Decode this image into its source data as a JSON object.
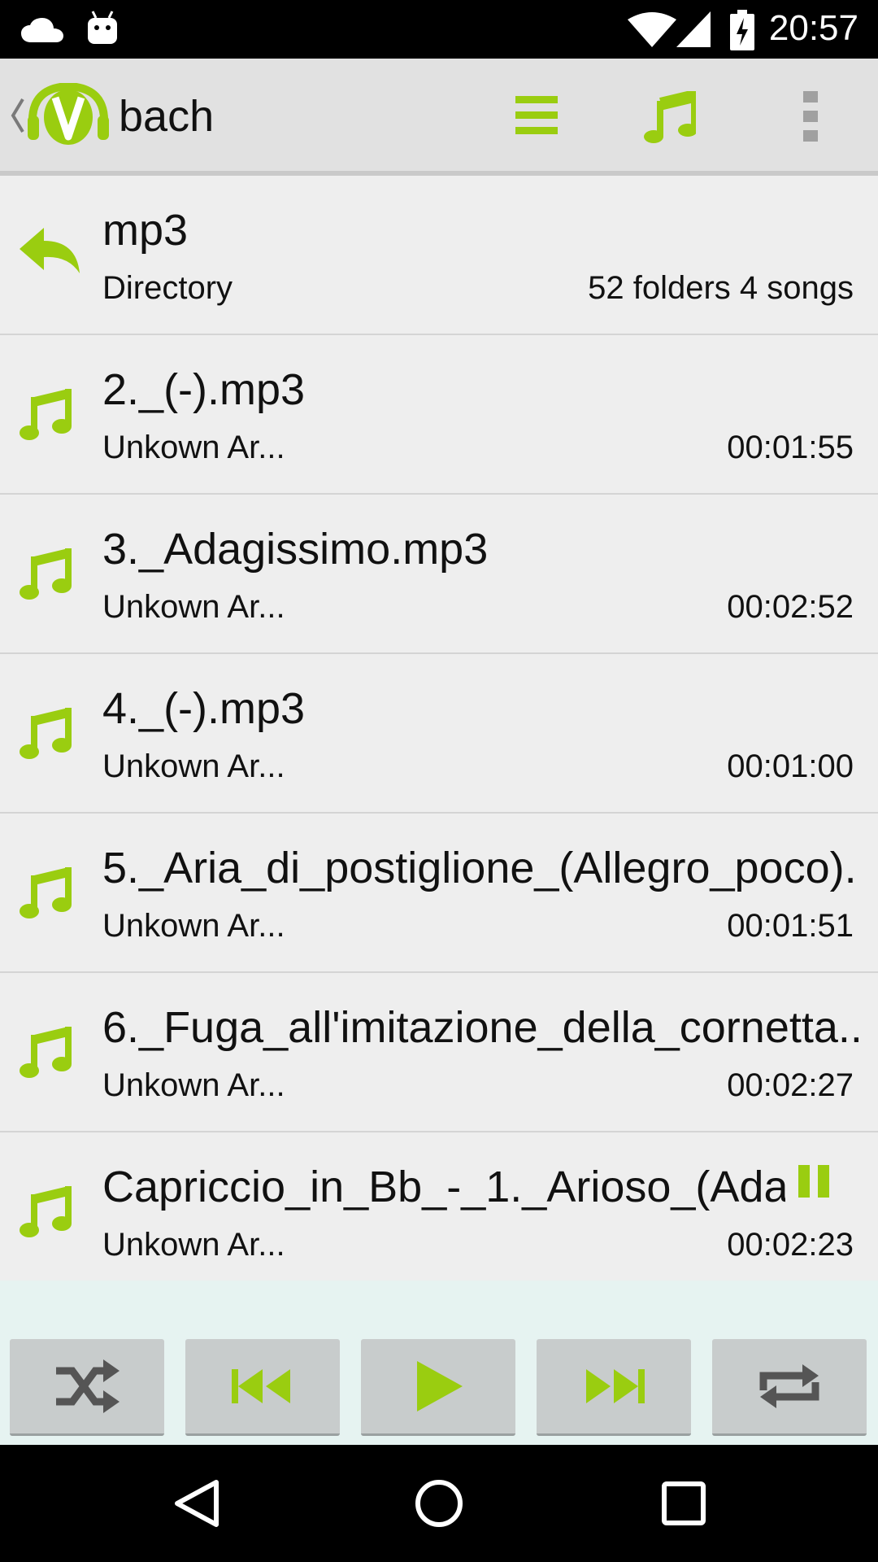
{
  "status_bar": {
    "time": "20:57",
    "icons": [
      "cloud-icon",
      "android-icon",
      "wifi-icon",
      "cell-signal-icon",
      "battery-charging-icon"
    ]
  },
  "action_bar": {
    "title": "bach",
    "icons": [
      "back-chevron-icon",
      "app-logo-icon",
      "list-menu-icon",
      "music-note-icon",
      "overflow-menu-icon"
    ]
  },
  "directory": {
    "name": "mp3",
    "type_label": "Directory",
    "summary": "52 folders 4 songs"
  },
  "songs": [
    {
      "title": "2._(-).mp3",
      "artist": "Unkown Ar...",
      "duration": "00:01:55"
    },
    {
      "title": "3._Adagissimo.mp3",
      "artist": "Unkown Ar...",
      "duration": "00:02:52"
    },
    {
      "title": "4._(-).mp3",
      "artist": "Unkown Ar...",
      "duration": "00:01:00"
    },
    {
      "title": "5._Aria_di_postiglione_(Allegro_poco)..",
      "artist": "Unkown Ar...",
      "duration": "00:01:51"
    },
    {
      "title": "6._Fuga_all'imitazione_della_cornetta..",
      "artist": "Unkown Ar...",
      "duration": "00:02:27"
    },
    {
      "title": "Capriccio_in_Bb_-_1._Arioso_(Ada..",
      "artist": "Unkown Ar...",
      "duration": "00:02:23",
      "state": "paused-indicator"
    }
  ],
  "controls": [
    "shuffle-icon",
    "previous-icon",
    "play-icon",
    "next-icon",
    "repeat-icon"
  ],
  "nav": [
    "back-triangle-icon",
    "home-circle-icon",
    "recents-square-icon"
  ],
  "colors": {
    "accent": "#9acd10",
    "list_bg": "#eeeeee",
    "action_bar_bg": "#e1e1e1",
    "controls_bg": "#e6f3f1",
    "control_button_bg": "#c8cccc"
  }
}
